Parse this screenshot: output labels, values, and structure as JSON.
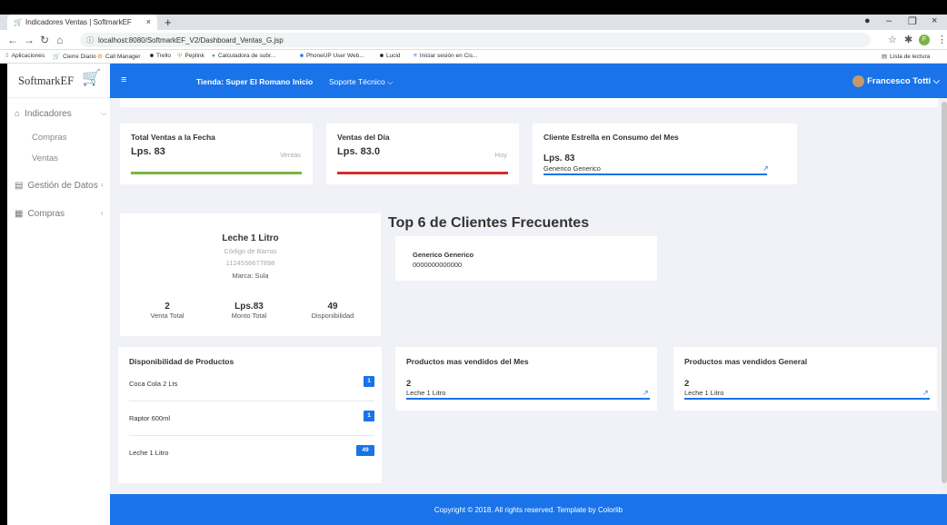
{
  "browser": {
    "tab_title": "Indicadores Ventas | SoftmarkEF",
    "url": "localhost:8080/SoftmarkEF_V2/Dashboard_Ventas_G.jsp",
    "url_host": "localhost",
    "bookmarks": [
      "Aplicaciones",
      "Cierre Diario",
      "Call Manager",
      "Trello",
      "Peplink",
      "Calculadora de subr...",
      "PhoneUP User Web...",
      "Lucid",
      "Iniciar sesión en Cis..."
    ],
    "reading_list": "Lista de lectura",
    "profile_initial": "F"
  },
  "brand": {
    "name": "SoftmarkEF"
  },
  "sidebar": {
    "items": [
      {
        "label": "Indicadores",
        "icon": "home-icon"
      },
      {
        "label": "Gestión de Datos",
        "icon": "document-icon"
      },
      {
        "label": "Compras",
        "icon": "table-icon"
      }
    ],
    "subitems": [
      "Compras",
      "Ventas"
    ]
  },
  "topnav": {
    "menu_icon": "hamburger-icon",
    "store": "Tienda: Super El Romano",
    "inicio": "Inicio",
    "soporte": "Soporte Técnico",
    "user": "Francesco Totti"
  },
  "cards": {
    "total_ventas": {
      "title": "Total Ventas a la Fecha",
      "value": "Lps. 83",
      "side": "Ventas",
      "color": "#7cb342"
    },
    "ventas_dia": {
      "title": "Ventas del Día",
      "value": "Lps. 83.0",
      "side": "Hoy",
      "color": "#d32f2f"
    },
    "cliente_estrella": {
      "title": "Cliente Estrella en Consumo del Mes",
      "value": "Lps. 83",
      "name": "Generico Generico"
    }
  },
  "product": {
    "name": "Leche 1 Litro",
    "barcode_label": "Código de Barras",
    "barcode": "1124556677898",
    "brand": "Marca: Sula",
    "stats": [
      {
        "value": "2",
        "label": "Venta Total"
      },
      {
        "value": "Lps.83",
        "label": "Monto Total"
      },
      {
        "value": "49",
        "label": "Disponibilidad"
      }
    ]
  },
  "top_clients": {
    "title": "Top 6 de Clientes Frecuentes",
    "items": [
      {
        "name": "Generico Generico",
        "id": "0000000000000"
      }
    ]
  },
  "disponibilidad": {
    "title": "Disponibilidad de Productos",
    "items": [
      {
        "name": "Coca Cola 2 Lts",
        "qty": "1"
      },
      {
        "name": "Raptor 600ml",
        "qty": "1"
      },
      {
        "name": "Leche 1 Litro",
        "qty": "49"
      }
    ]
  },
  "mas_vendidos_mes": {
    "title": "Productos mas vendidos del Mes",
    "value": "2",
    "name": "Leche 1 Litro"
  },
  "mas_vendidos_general": {
    "title": "Productos mas vendidos General",
    "value": "2",
    "name": "Leche 1 Litro"
  },
  "footer": {
    "text": "Copyright © 2018. All rights reserved. Template by Colorlib"
  }
}
